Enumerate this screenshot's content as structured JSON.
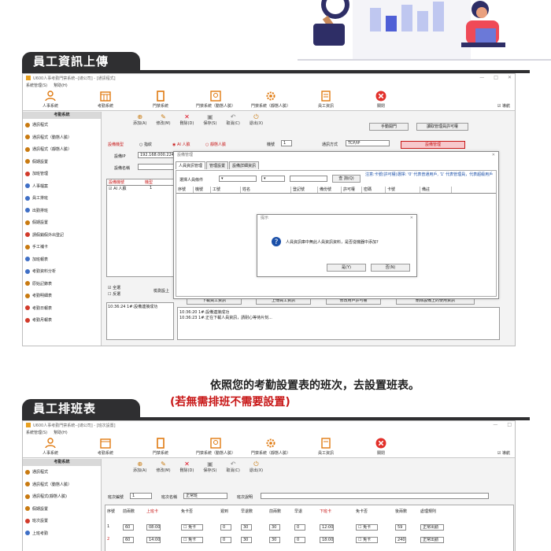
{
  "section1": {
    "banner": "員工資訊上傳"
  },
  "section2": {
    "banner": "員工排班表",
    "caption_line1": "依照您的考勤設置表的班次，去設置班表。",
    "caption_line2": "(若無需排班不需要設置)"
  },
  "colors": {
    "banner_bg": "#2f2f31",
    "accent_red": "#c81818",
    "dialog_blue": "#1a4fa8"
  },
  "window1": {
    "title": "U600人事考勤門禁系統--[總公司] - [通訊程式]",
    "menu": [
      "系統管理(S)",
      "幫助(H)"
    ],
    "toolbar": [
      "人事系統",
      "考勤系統",
      "門禁系統",
      "門禁系統（動態人臉）",
      "門禁系統（靜態人臉）",
      "員工資訊",
      "關閉"
    ],
    "auto_label": "☑ 導航",
    "sidebar_header": "考勤系統",
    "sidebar": [
      "通訊程式",
      "通訊程式（動態人臉）",
      "通訊程式（靜態人臉）",
      "假期設置",
      "加班管理",
      "人事檔案",
      "員工排班",
      "出勤排班",
      "假期設置",
      "請假銷假外出登記",
      "手工補卡",
      "加班報表",
      "考勤資料分析",
      "原始記錄表",
      "考勤明細表",
      "考勤日報表",
      "考勤月報表"
    ],
    "subtoolbar": [
      "添加(A)",
      "修改(M)",
      "刪除(D)",
      "保存(S)",
      "取消(C)",
      "退出(X)"
    ],
    "fields": {
      "device_model_label": "設備機型",
      "radio_fp": "指紋",
      "radio_ai": "AI 人臉",
      "radio_static": "靜態人臉",
      "machine_no_label": "機號",
      "machine_no": "1",
      "comm_mode_label": "通訊方式",
      "comm_mode": "TCP/IP",
      "ip_label": "設備IP",
      "ip": "192.168.000.224",
      "name_label": "設備名稱"
    },
    "right_buttons": [
      "手動開門",
      "設備管理",
      "讀取管理員許可權"
    ],
    "device_table": {
      "headers": [
        "設備機號",
        "機型"
      ],
      "row": [
        "☑ AI 人臉",
        "1"
      ]
    },
    "bottom_checks": [
      "☑ 全選",
      "☐ 反選"
    ],
    "log_left": "10:36:24  1#:設備連接成功",
    "batch_label": "檢測設上",
    "bottom_buttons": [
      "下載員工資訊",
      "上傳員工資訊",
      "修改用戶許可權",
      "刪除設備上的使用資訊"
    ],
    "log_right": [
      "10:36:20  1#:設備連接成功",
      "10:36:23  1#:正在下載人員資訊，請耐心等待片刻..."
    ]
  },
  "dialog1": {
    "title": "設備管理",
    "tabs": [
      "人員資訊管理",
      "管理設置",
      "設備詳細資訊"
    ],
    "search_label": "選擇人員條件",
    "query_button": "查 詢(Q)",
    "note": "注意:卡號(許可權)選擇: '0' 代表普通用戶, '1' 代表管理員，代表超級用戶",
    "columns": [
      "序號",
      "機號",
      "工號",
      "姓名",
      "登記號",
      "備份號",
      "許可權",
      "密碼",
      "卡號",
      "備註"
    ]
  },
  "dialog2": {
    "title": "提示",
    "message": "人員資訊庫中無此人員資訊資料，是否從機器中添加?",
    "yes": "是(Y)",
    "no": "否(N)"
  },
  "window2": {
    "title": "U600人事考勤門禁系統--[總公司] - [班次設置]",
    "menu": [
      "系統管理(S)",
      "幫助(H)"
    ],
    "toolbar": [
      "人事系統",
      "考勤系統",
      "門禁系統",
      "門禁系統（動態人臉）",
      "門禁系統（靜態人臉）",
      "員工資訊",
      "關閉"
    ],
    "auto_label": "☑ 導航",
    "sidebar_header": "考勤系統",
    "sidebar": [
      "通訊程式",
      "通訊程式（動態人臉）",
      "通訊程式(靜態人臉)",
      "假期設置",
      "班次設置",
      "上班考勤"
    ],
    "subtoolbar": [
      "添加(A)",
      "修改(M)",
      "刪除(D)",
      "保存(S)",
      "取消(C)",
      "退出(X)"
    ],
    "shift_no_label": "班次編號",
    "shift_no": "1",
    "shift_name_label": "班次名稱",
    "shift_name": "正常班",
    "shift_desc_label": "班次說明",
    "table_headers": [
      "序號",
      "前兩數",
      "上班卡",
      "免卡否",
      "遲到",
      "早退數",
      "前兩數",
      "早退",
      "下班卡",
      "免卡否",
      "後兩數",
      "處理規則"
    ],
    "rows": [
      {
        "no": "1",
        "a": "60",
        "on": "08:00",
        "free": "☐ 免卡",
        "late": "0",
        "b": "30",
        "c": "30",
        "d": "0",
        "off": "12:00",
        "free2": "☐ 免卡",
        "e": "59",
        "rule": "正常出勤"
      },
      {
        "no": "2",
        "a": "60",
        "on": "14:00",
        "free": "☐ 免卡",
        "late": "0",
        "b": "30",
        "c": "30",
        "d": "0",
        "off": "18:00",
        "free2": "☐ 免卡",
        "e": "240",
        "rule": "正常出勤"
      }
    ]
  }
}
